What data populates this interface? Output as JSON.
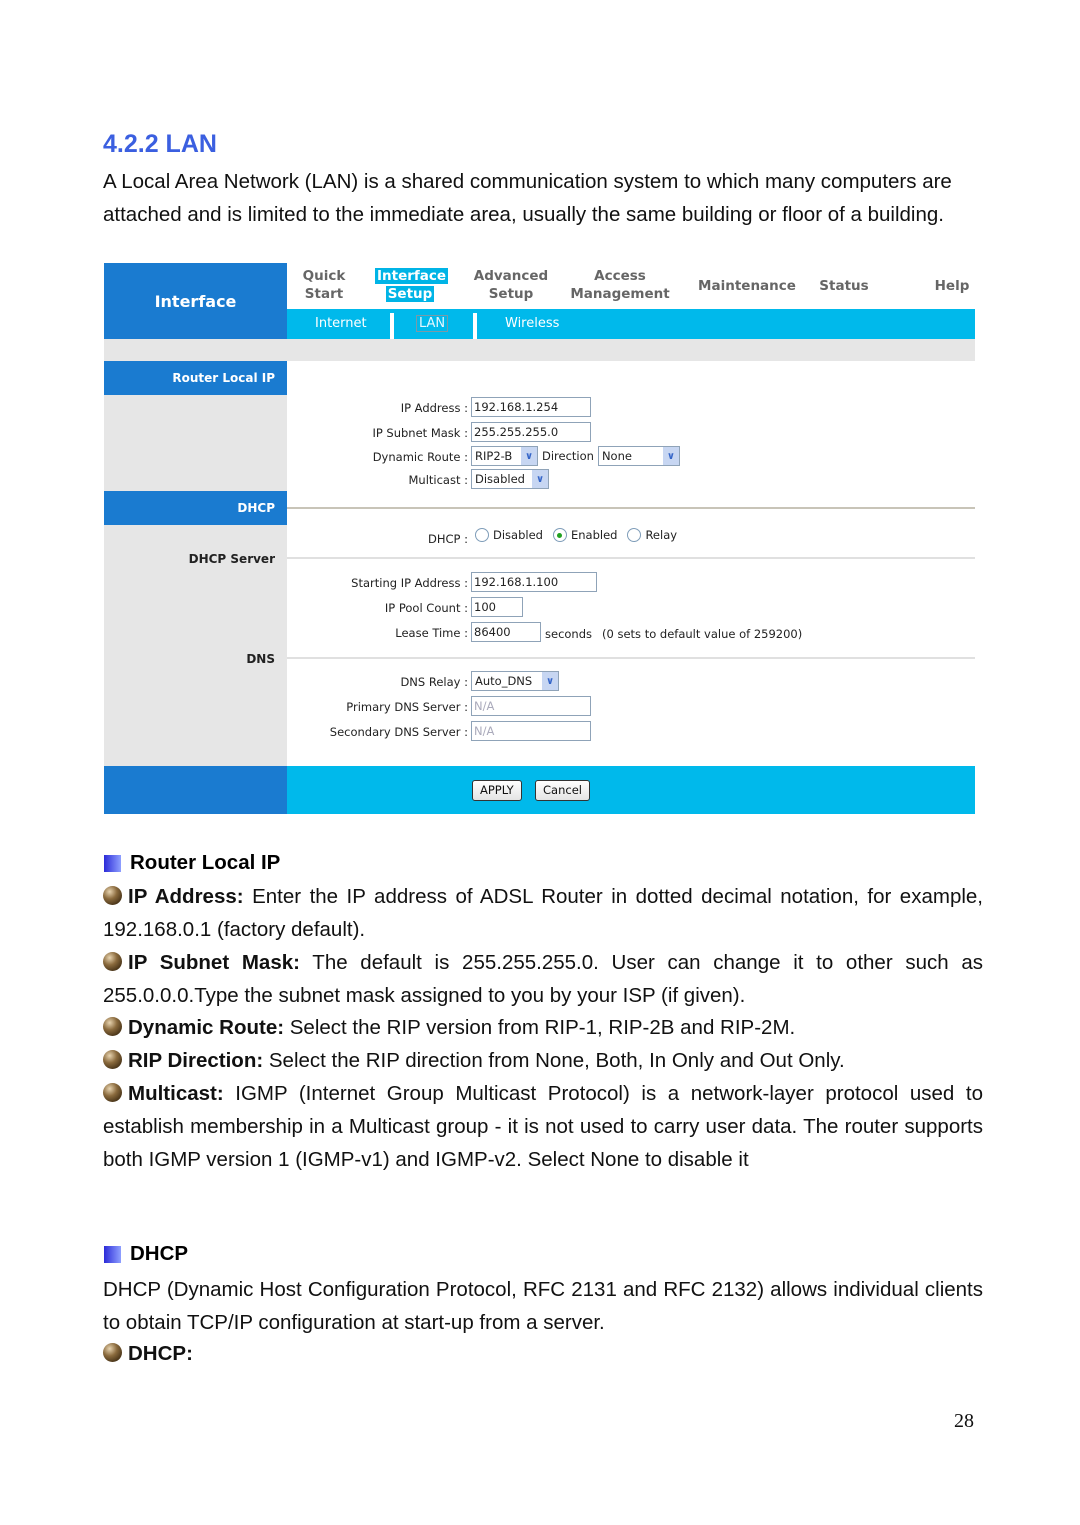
{
  "heading": "4.2.2 LAN",
  "intro": "A Local Area Network (LAN) is a shared communication system to which many computers are attached and is limited to the immediate area, usually the same building or floor of a building.",
  "ui": {
    "brand": "Interface",
    "topnav": [
      {
        "line1": "Quick",
        "line2": "Start",
        "active": false
      },
      {
        "line1": "Interface",
        "line2": "Setup",
        "active": true
      },
      {
        "line1": "Advanced",
        "line2": "Setup",
        "active": false
      },
      {
        "line1": "Access",
        "line2": "Management",
        "active": false
      },
      {
        "line1": "Maintenance",
        "line2": "",
        "active": false
      },
      {
        "line1": "Status",
        "line2": "",
        "active": false
      },
      {
        "line1": "Help",
        "line2": "",
        "active": false
      }
    ],
    "subnav": [
      {
        "label": "Internet",
        "active": false
      },
      {
        "label": "LAN",
        "active": true
      },
      {
        "label": "Wireless",
        "active": false
      }
    ],
    "sections": {
      "router_local_ip": "Router Local IP",
      "dhcp": "DHCP",
      "dhcp_server": "DHCP Server",
      "dns": "DNS"
    },
    "fields": {
      "ip_address": {
        "label": "IP Address :",
        "value": "192.168.1.254"
      },
      "subnet_mask": {
        "label": "IP Subnet Mask :",
        "value": "255.255.255.0"
      },
      "dynamic_route": {
        "label": "Dynamic Route :",
        "value": "RIP2-B"
      },
      "direction": {
        "label": "Direction",
        "value": "None"
      },
      "multicast": {
        "label": "Multicast :",
        "value": "Disabled"
      },
      "dhcp": {
        "label": "DHCP :",
        "options": [
          "Disabled",
          "Enabled",
          "Relay"
        ],
        "selected": "Enabled"
      },
      "starting_ip": {
        "label": "Starting IP Address :",
        "value": "192.168.1.100"
      },
      "pool_count": {
        "label": "IP Pool Count :",
        "value": "100"
      },
      "lease_time": {
        "label": "Lease Time :",
        "value": "86400",
        "unit": "seconds",
        "hint": "(0 sets to default value of 259200)"
      },
      "dns_relay": {
        "label": "DNS Relay :",
        "value": "Auto_DNS"
      },
      "primary_dns": {
        "label": "Primary DNS Server :",
        "value": "N/A"
      },
      "secondary_dns": {
        "label": "Secondary DNS Server :",
        "value": "N/A"
      }
    },
    "buttons": {
      "apply": "APPLY",
      "cancel": "Cancel"
    }
  },
  "router_local_ip_title": "Router Local IP",
  "bullets": [
    {
      "term": "IP Address:",
      "text": " Enter the IP address of ADSL Router in dotted decimal notation, for example, 192.168.0.1 (factory default)."
    },
    {
      "term": "IP Subnet Mask:",
      "text": " The default is 255.255.255.0. User can change it to other such as 255.0.0.0.Type the subnet mask assigned to you by your ISP (if given)."
    },
    {
      "term": "Dynamic Route:",
      "text": " Select the RIP version from RIP-1, RIP-2B and RIP-2M."
    },
    {
      "term": "RIP Direction:",
      "text": " Select the RIP direction from None, Both, In Only and Out Only."
    },
    {
      "term": "Multicast:",
      "text": " IGMP (Internet Group Multicast Protocol) is a network-layer protocol used to establish membership in a Multicast group - it is not used to carry user data.  The router supports both IGMP version 1 (IGMP-v1) and IGMP-v2. Select None to disable it"
    }
  ],
  "dhcp_title": "DHCP",
  "dhcp_text": "DHCP (Dynamic Host Configuration Protocol, RFC 2131 and RFC 2132) allows individual clients to obtain TCP/IP configuration at start-up from a server.",
  "dhcp_bullet": "DHCP:",
  "page_number": "28"
}
